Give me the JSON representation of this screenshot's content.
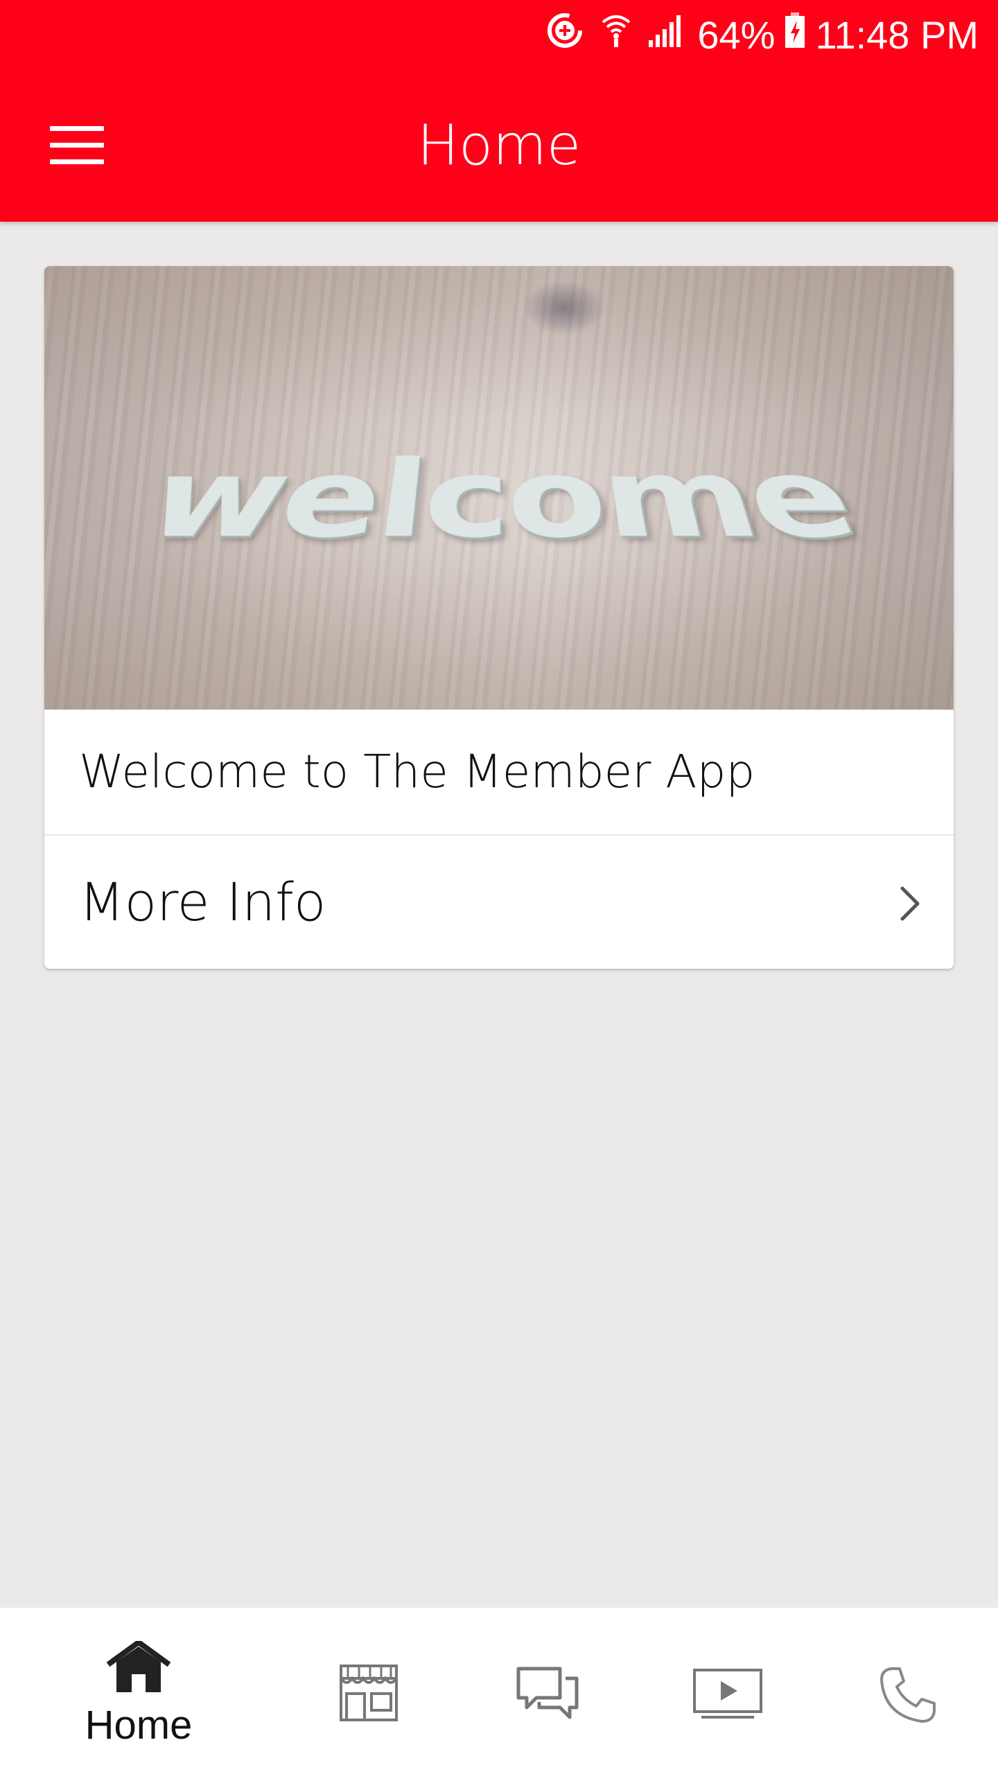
{
  "status_bar": {
    "battery_percent": "64%",
    "time": "11:48 PM",
    "icons": [
      "data-saver-icon",
      "wifi-icon",
      "signal-icon",
      "battery-charging-icon"
    ]
  },
  "header": {
    "title": "Home",
    "menu_icon": "hamburger-menu-icon",
    "color": "#ff0019"
  },
  "card": {
    "hero_text": "welcome",
    "title": "Welcome to The Member App",
    "more_info_label": "More Info",
    "chevron_icon": "chevron-right-icon"
  },
  "bottom_nav": {
    "items": [
      {
        "icon": "home-icon",
        "label": "Home",
        "active": true
      },
      {
        "icon": "store-icon",
        "label": "",
        "active": false
      },
      {
        "icon": "chat-icon",
        "label": "",
        "active": false
      },
      {
        "icon": "video-play-icon",
        "label": "",
        "active": false
      },
      {
        "icon": "phone-icon",
        "label": "",
        "active": false
      }
    ]
  }
}
